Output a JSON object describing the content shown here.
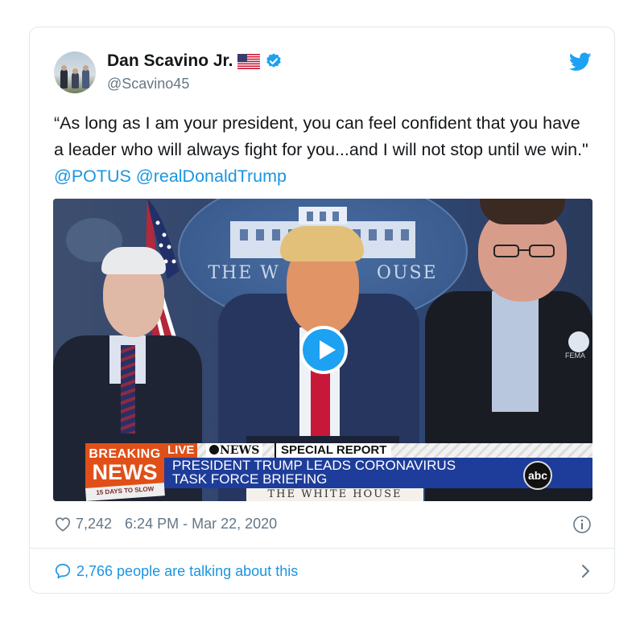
{
  "author": {
    "name": "Dan Scavino Jr.",
    "handle": "@Scavino45",
    "flag_emoji": "us-flag-icon",
    "verified": true
  },
  "tweet": {
    "text_before": "“As long as I am your president, you can feel confident that you have a leader who will always fight for you...and I will not stop until we win.\" ",
    "mentions": [
      "@POTUS",
      "@realDonaldTrump"
    ]
  },
  "media": {
    "backdrop_label": "THE WHITE HOUSE",
    "backdrop_visible": [
      "THE W",
      "OUSE"
    ],
    "patch_text": "FEMA",
    "breaking_line1": "BREAKING",
    "breaking_line2": "NEWS",
    "live_label": "LIVE",
    "network_label": "NEWS",
    "special_label": "SPECIAL REPORT",
    "headline_line1": "PRESIDENT TRUMP LEADS CORONAVIRUS",
    "headline_line2": "TASK FORCE BRIEFING",
    "logo_text": "abc",
    "bottom_sign": "THE WHITE HOUSE",
    "small_sign": "15 DAYS TO SLOW"
  },
  "meta": {
    "likes": "7,242",
    "timestamp": "6:24 PM - Mar 22, 2020"
  },
  "footer": {
    "talking": "2,766 people are talking about this"
  },
  "colors": {
    "link": "#1b95e0",
    "twitter_blue": "#1da1f2",
    "muted": "#657786",
    "breaking_orange": "#e04f18",
    "headline_blue": "#1e3d9a"
  }
}
